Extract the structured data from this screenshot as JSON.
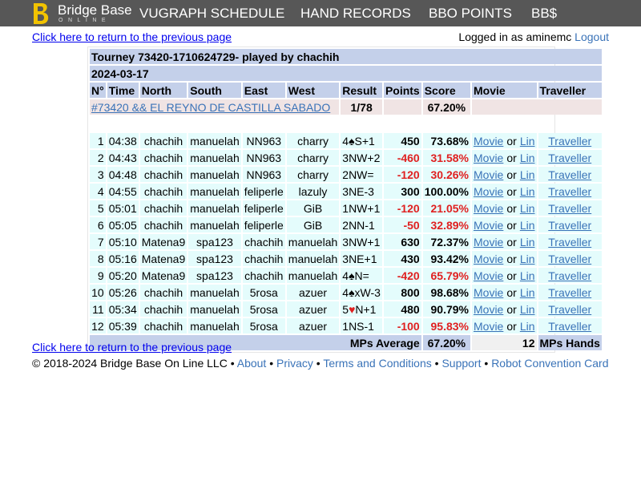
{
  "brand": {
    "name": "Bridge Base",
    "sub": "ONLINE"
  },
  "nav": [
    "VUGRAPH SCHEDULE",
    "HAND RECORDS",
    "BBO POINTS",
    "BB$"
  ],
  "back_link": "Click here to return to the previous page",
  "login": {
    "prefix": "Logged in as",
    "user": "aminemc",
    "logout": "Logout"
  },
  "table": {
    "title": "Tourney 73420-1710624729- played by chachih",
    "date": "2024-03-17",
    "headers": [
      "N°",
      "Time",
      "North",
      "South",
      "East",
      "West",
      "Result",
      "Points",
      "Score",
      "Movie",
      "Traveller"
    ],
    "tourney_link": "#73420 && EL REYNO DE CASTILLA SABADO",
    "tourney_rank": "1/78",
    "tourney_score": "67.20%",
    "rows": [
      {
        "n": "1",
        "time": "04:38",
        "north": "chachih",
        "south": "manuelah",
        "east": "NN963",
        "west": "charry",
        "res_pre": "4",
        "suit": "♠",
        "res_post": "S+1",
        "points": "450",
        "score": "73.68%",
        "neg": false
      },
      {
        "n": "2",
        "time": "04:43",
        "north": "chachih",
        "south": "manuelah",
        "east": "NN963",
        "west": "charry",
        "res_pre": "3NW+2",
        "suit": "",
        "res_post": "",
        "points": "-460",
        "score": "31.58%",
        "neg": true
      },
      {
        "n": "3",
        "time": "04:48",
        "north": "chachih",
        "south": "manuelah",
        "east": "NN963",
        "west": "charry",
        "res_pre": "2NW=",
        "suit": "",
        "res_post": "",
        "points": "-120",
        "score": "30.26%",
        "neg": true
      },
      {
        "n": "4",
        "time": "04:55",
        "north": "chachih",
        "south": "manuelah",
        "east": "feliperle",
        "west": "lazuly",
        "res_pre": "3NE-3",
        "suit": "",
        "res_post": "",
        "points": "300",
        "score": "100.00%",
        "neg": false
      },
      {
        "n": "5",
        "time": "05:01",
        "north": "chachih",
        "south": "manuelah",
        "east": "feliperle",
        "west": "GiB",
        "res_pre": "1NW+1",
        "suit": "",
        "res_post": "",
        "points": "-120",
        "score": "21.05%",
        "neg": true
      },
      {
        "n": "6",
        "time": "05:05",
        "north": "chachih",
        "south": "manuelah",
        "east": "feliperle",
        "west": "GiB",
        "res_pre": "2NN-1",
        "suit": "",
        "res_post": "",
        "points": "-50",
        "score": "32.89%",
        "neg": true
      },
      {
        "n": "7",
        "time": "05:10",
        "north": "Matena9",
        "south": "spa123",
        "east": "chachih",
        "west": "manuelah",
        "res_pre": "3NW+1",
        "suit": "",
        "res_post": "",
        "points": "630",
        "score": "72.37%",
        "neg": false
      },
      {
        "n": "8",
        "time": "05:16",
        "north": "Matena9",
        "south": "spa123",
        "east": "chachih",
        "west": "manuelah",
        "res_pre": "3NE+1",
        "suit": "",
        "res_post": "",
        "points": "430",
        "score": "93.42%",
        "neg": false
      },
      {
        "n": "9",
        "time": "05:20",
        "north": "Matena9",
        "south": "spa123",
        "east": "chachih",
        "west": "manuelah",
        "res_pre": "4",
        "suit": "♠",
        "res_post": "N=",
        "points": "-420",
        "score": "65.79%",
        "neg": true
      },
      {
        "n": "10",
        "time": "05:26",
        "north": "chachih",
        "south": "manuelah",
        "east": "5rosa",
        "west": "azuer",
        "res_pre": "4",
        "suit": "♠",
        "res_post": "xW-3",
        "points": "800",
        "score": "98.68%",
        "neg": false
      },
      {
        "n": "11",
        "time": "05:34",
        "north": "chachih",
        "south": "manuelah",
        "east": "5rosa",
        "west": "azuer",
        "res_pre": "5",
        "suit": "♥",
        "res_post": "N+1",
        "points": "480",
        "score": "90.79%",
        "neg": false
      },
      {
        "n": "12",
        "time": "05:39",
        "north": "chachih",
        "south": "manuelah",
        "east": "5rosa",
        "west": "azuer",
        "res_pre": "1NS-1",
        "suit": "",
        "res_post": "",
        "points": "-100",
        "score": "95.83%",
        "neg": true
      }
    ],
    "movie_label": "Movie",
    "or_label": "or",
    "lin_label": "Lin",
    "traveller_label": "Traveller",
    "footer_label": "MPs Average",
    "footer_avg": "67.20%",
    "footer_count": "12",
    "footer_hands": "MPs Hands"
  },
  "footer": {
    "copyright": "© 2018-2024 Bridge Base On Line LLC",
    "links": [
      "About",
      "Privacy",
      "Terms and Conditions",
      "Support",
      "Robot Convention Card"
    ]
  },
  "colors": {
    "topbar": "#575757",
    "header_bg": "#c4d0ea",
    "row_bg": "#e4fcfc",
    "negative": "#e02020",
    "link": "#3a73b8"
  }
}
